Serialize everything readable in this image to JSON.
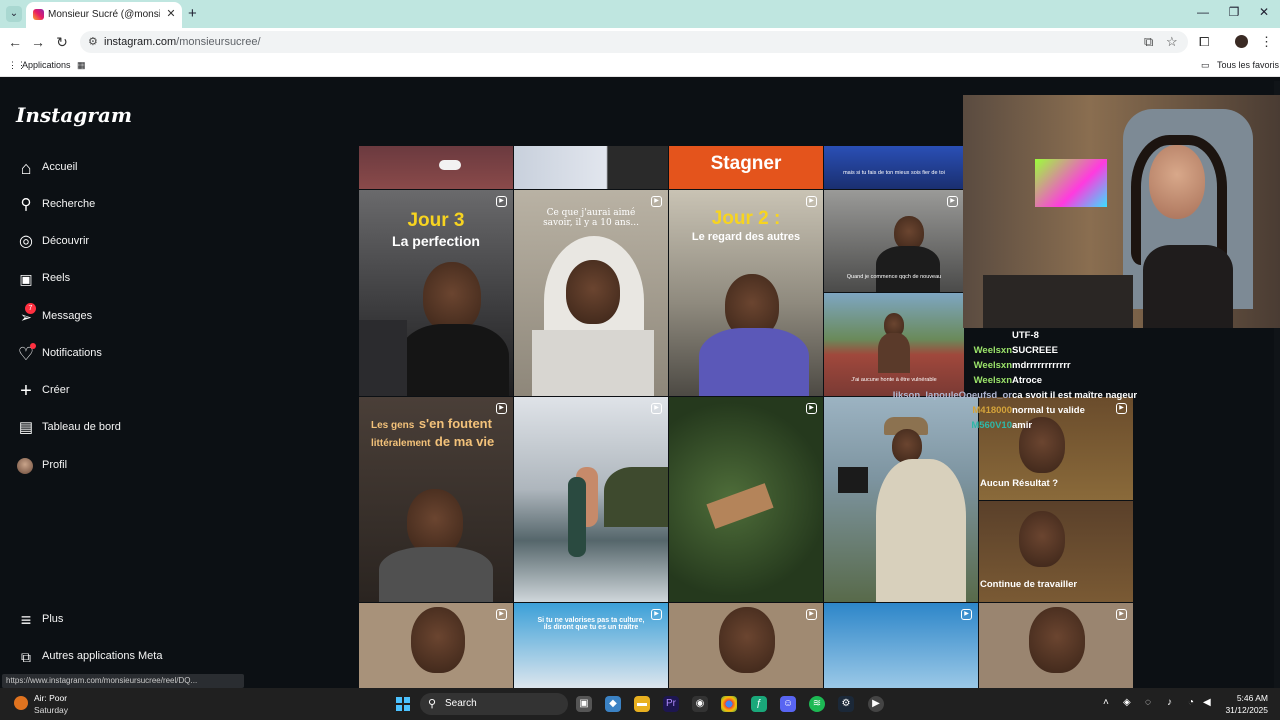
{
  "browser": {
    "tab_title": "Monsieur Sucré (@monsieursucree)",
    "url_host": "instagram.com",
    "url_path": "/monsieursucree/",
    "bookmarks": {
      "apps": "Applications",
      "all_favorites": "Tous les favoris"
    }
  },
  "instagram": {
    "logo": "Instagram",
    "nav": [
      {
        "label": "Accueil",
        "icon": "home-icon"
      },
      {
        "label": "Recherche",
        "icon": "search-icon"
      },
      {
        "label": "Découvrir",
        "icon": "compass-icon"
      },
      {
        "label": "Reels",
        "icon": "reels-icon"
      },
      {
        "label": "Messages",
        "icon": "messenger-icon",
        "badge": "7"
      },
      {
        "label": "Notifications",
        "icon": "heart-icon"
      },
      {
        "label": "Créer",
        "icon": "plus-icon"
      },
      {
        "label": "Tableau de bord",
        "icon": "dashboard-icon"
      },
      {
        "label": "Profil",
        "icon": "profile-avatar"
      }
    ],
    "bottom_nav": [
      {
        "label": "Plus",
        "icon": "menu-icon"
      },
      {
        "label": "Autres applications Meta",
        "icon": "meta-apps-icon"
      }
    ],
    "posts": {
      "p_stagner": "Stagner",
      "p_small_caption": "mais si tu fais de ton mieux sois fier de toi",
      "p_jour3_title": "Jour 3",
      "p_jour3_sub": "La perfection",
      "p_hoodie": "Ce que j'aurai aimé savoir, il y a 10 ans...",
      "p_jour2_title": "Jour 2 :",
      "p_jour2_sub": "Le regard des autres",
      "p_gym_caption": "Quand je commence qqch de nouveau",
      "p_track_caption": "J'ai aucune honte à être vulnérable",
      "p_gens_1": "Les gens",
      "p_gens_2": "s'en foutent",
      "p_gens_3": "littéralement",
      "p_gens_4": "de ma vie",
      "p_culture": "Si tu ne valorises pas ta culture, ils diront que tu es un traître"
    }
  },
  "stream": {
    "chat": [
      {
        "user": "",
        "message": "UTF-8",
        "color": "#ffffff"
      },
      {
        "user": "Weelsxn",
        "message": "SUCREEE",
        "color": "#9be36a"
      },
      {
        "user": "Weelsxn",
        "message": "mdrrrrrrrrrrrr",
        "color": "#9be36a"
      },
      {
        "user": "Weelsxn",
        "message": "Atroce",
        "color": "#9be36a"
      },
      {
        "user": "Iikson_lapouleOoeufsd_or",
        "message": "ca svoit il est maître nageur",
        "color": "#b0b6d0"
      },
      {
        "user": "M418000",
        "message": "normal tu valide",
        "color": "#d4a33a"
      },
      {
        "user": "M560V10",
        "message": "amir",
        "color": "#2fb8a8"
      }
    ],
    "overlay_1": "Aucun Résultat ?",
    "overlay_2": "Continue de travailler"
  },
  "status_url": "https://www.instagram.com/monsieursucree/reel/DQ...",
  "taskbar": {
    "weather_1": "Air: Poor",
    "weather_2": "Saturday",
    "search": "Search",
    "time": "5:46 AM",
    "date": "31/12/2025"
  }
}
